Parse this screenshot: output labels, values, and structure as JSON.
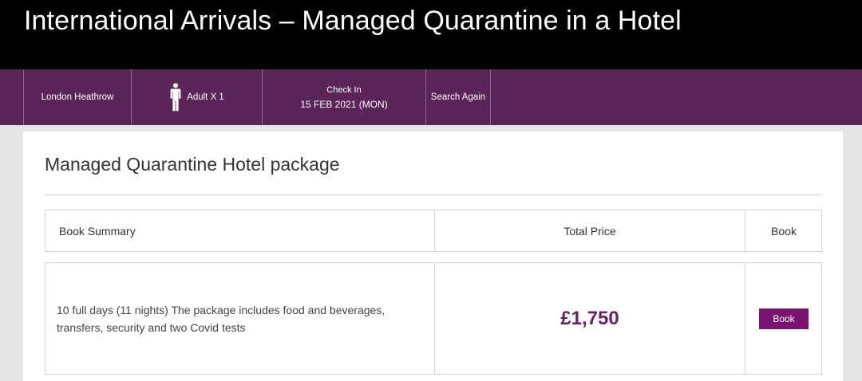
{
  "header": {
    "title": "International Arrivals – Managed Quarantine in a Hotel"
  },
  "search": {
    "location": "London Heathrow",
    "guests": "Adult X 1",
    "checkin_label": "Check In",
    "checkin_date": "15 FEB 2021 (MON)",
    "search_again": "Search Again"
  },
  "package": {
    "title": "Managed Quarantine Hotel package",
    "columns": {
      "summary": "Book Summary",
      "price": "Total Price",
      "book": "Book"
    },
    "row": {
      "summary": "10 full days (11 nights) The package includes food and beverages, transfers, security and two Covid tests",
      "price": "£1,750",
      "book_label": "Book"
    }
  },
  "colors": {
    "header_bg": "#000000",
    "searchbar_bg": "#5c2559",
    "price": "#6e1f62",
    "button": "#7a1270"
  },
  "icons": {
    "guests": "person-icon"
  }
}
